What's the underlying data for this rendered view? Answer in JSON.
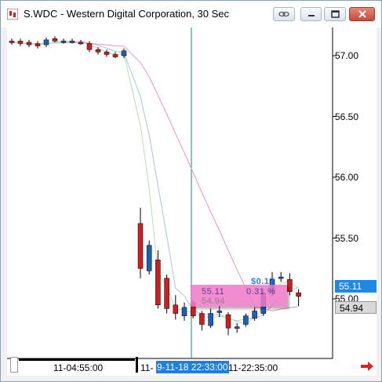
{
  "window": {
    "title": "S.WDC - Western Digital Corporation, 30 Sec"
  },
  "price_axis": {
    "ticks": [
      "57.00",
      "56.50",
      "56.00",
      "55.50",
      "55.00"
    ]
  },
  "tags": {
    "last_price": "55.11",
    "close_price": "54.94"
  },
  "time_axis": {
    "labels": [
      "11-04:55:00",
      "11-",
      "11-22:35:00"
    ],
    "cursor_time": "9-11-18 22:33:00"
  },
  "info_box": {
    "value": "55.11",
    "percent": "0.31 %",
    "previous": "54.94",
    "change": "$0.17"
  },
  "colors": {
    "bull": "#1e5fb0",
    "bear": "#cc1f1f",
    "ma_pink": "#f090c8",
    "ma_blue": "#a8c4e4",
    "ma_green": "#b8dcb0",
    "cursor_line": "#1a8a8a",
    "accent": "#1e88e5"
  },
  "chart_data": {
    "type": "candlestick",
    "ylim": [
      54.6,
      57.3
    ],
    "candles": [
      {
        "o": 57.12,
        "h": 57.14,
        "l": 57.09,
        "c": 57.11
      },
      {
        "o": 57.12,
        "h": 57.14,
        "l": 57.08,
        "c": 57.1
      },
      {
        "o": 57.11,
        "h": 57.13,
        "l": 57.07,
        "c": 57.09
      },
      {
        "o": 57.1,
        "h": 57.12,
        "l": 57.06,
        "c": 57.08
      },
      {
        "o": 57.09,
        "h": 57.15,
        "l": 57.07,
        "c": 57.13
      },
      {
        "o": 57.14,
        "h": 57.16,
        "l": 57.11,
        "c": 57.12
      },
      {
        "o": 57.12,
        "h": 57.14,
        "l": 57.1,
        "c": 57.12
      },
      {
        "o": 57.12,
        "h": 57.14,
        "l": 57.1,
        "c": 57.12
      },
      {
        "o": 57.11,
        "h": 57.13,
        "l": 57.09,
        "c": 57.1
      },
      {
        "o": 57.1,
        "h": 57.12,
        "l": 57.03,
        "c": 57.05
      },
      {
        "o": 57.05,
        "h": 57.07,
        "l": 57.01,
        "c": 57.03
      },
      {
        "o": 57.03,
        "h": 57.05,
        "l": 56.99,
        "c": 57.01
      },
      {
        "o": 57.01,
        "h": 57.03,
        "l": 56.98,
        "c": 56.99
      },
      {
        "o": 57.0,
        "h": 57.06,
        "l": 56.98,
        "c": 57.04
      },
      {
        "o": 55.62,
        "h": 55.75,
        "l": 55.17,
        "c": 55.25
      },
      {
        "o": 55.23,
        "h": 55.48,
        "l": 55.2,
        "c": 55.44
      },
      {
        "o": 55.32,
        "h": 55.4,
        "l": 54.92,
        "c": 54.95
      },
      {
        "o": 55.17,
        "h": 55.2,
        "l": 54.88,
        "c": 54.92
      },
      {
        "o": 54.95,
        "h": 55.03,
        "l": 54.83,
        "c": 54.88
      },
      {
        "o": 54.86,
        "h": 54.97,
        "l": 54.82,
        "c": 54.93
      },
      {
        "o": 54.97,
        "h": 54.99,
        "l": 54.84,
        "c": 54.86
      },
      {
        "o": 54.88,
        "h": 54.9,
        "l": 54.74,
        "c": 54.79
      },
      {
        "o": 54.78,
        "h": 54.92,
        "l": 54.76,
        "c": 54.88
      },
      {
        "o": 54.89,
        "h": 54.95,
        "l": 54.85,
        "c": 54.9
      },
      {
        "o": 54.87,
        "h": 54.89,
        "l": 54.7,
        "c": 54.76
      },
      {
        "o": 54.76,
        "h": 54.8,
        "l": 54.72,
        "c": 54.77
      },
      {
        "o": 54.79,
        "h": 54.88,
        "l": 54.77,
        "c": 54.86
      },
      {
        "o": 54.84,
        "h": 54.93,
        "l": 54.82,
        "c": 54.9
      },
      {
        "o": 54.88,
        "h": 55.08,
        "l": 54.86,
        "c": 55.05
      },
      {
        "o": 55.05,
        "h": 55.22,
        "l": 55.02,
        "c": 55.16
      },
      {
        "o": 55.18,
        "h": 55.22,
        "l": 55.14,
        "c": 55.18
      },
      {
        "o": 55.16,
        "h": 55.21,
        "l": 55.03,
        "c": 55.06
      },
      {
        "o": 55.05,
        "h": 55.08,
        "l": 54.94,
        "c": 55.02
      }
    ]
  }
}
